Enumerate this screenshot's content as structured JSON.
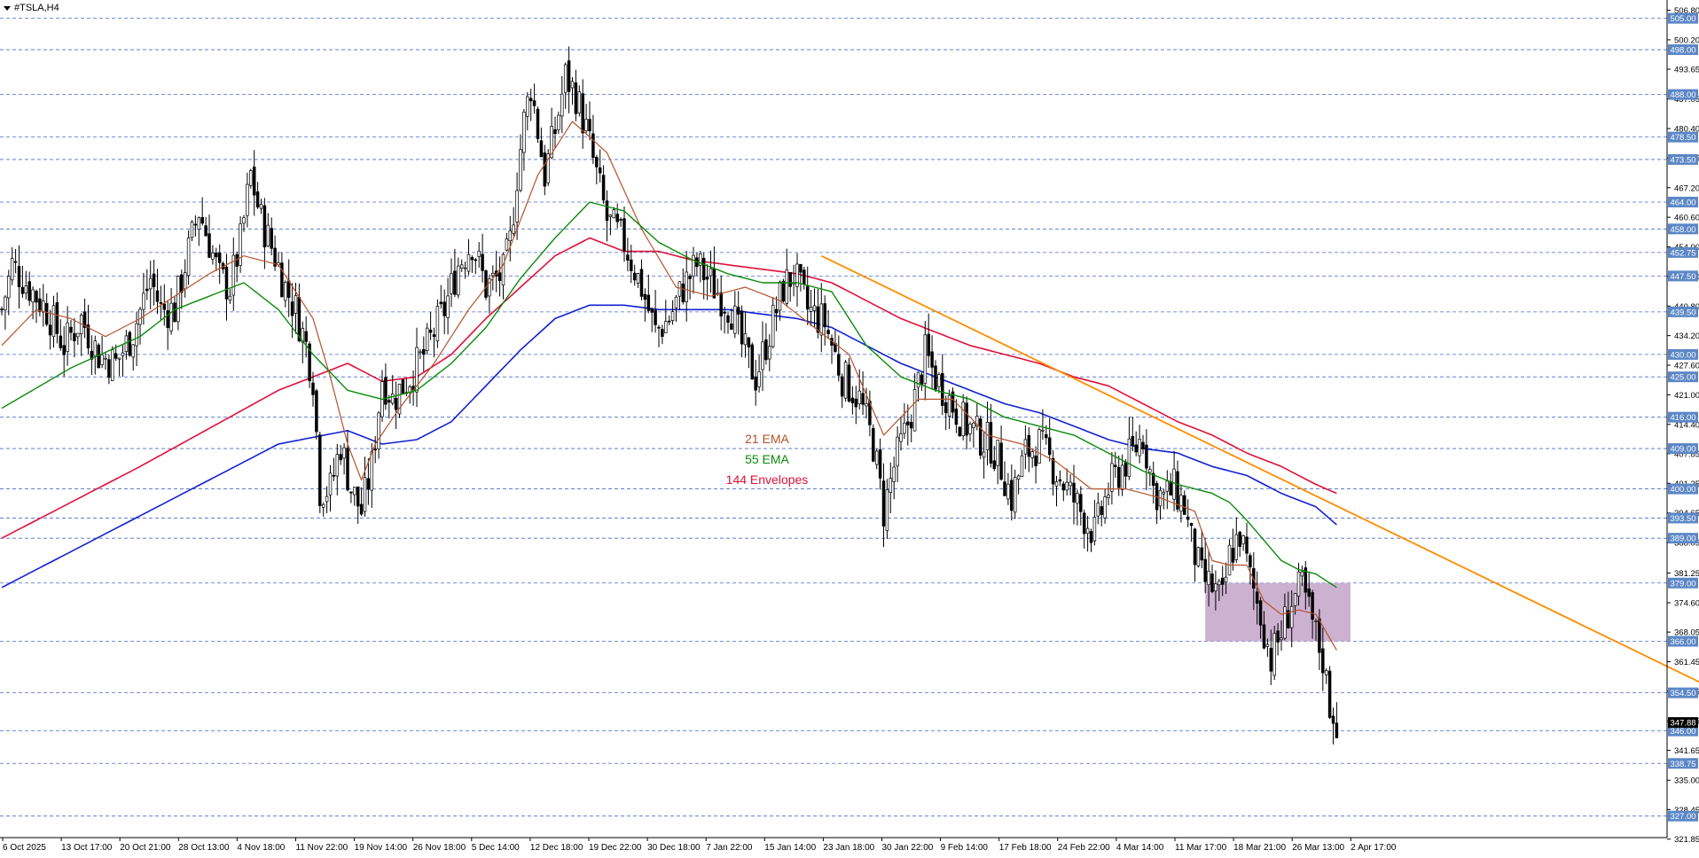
{
  "window": {
    "symbol_title": "#TSLA,H4"
  },
  "colors": {
    "background": "#ffffff",
    "grid": "#9aa8c8",
    "level_line": "#4a6bcc",
    "level_label_bg": "#5b87c6",
    "candle": "#000000",
    "ema21": "#b5532a",
    "ema55": "#0a8a0a",
    "envelope_upper": "#e0103a",
    "envelope_lower": "#1020d0",
    "trendline": "#ff8c00",
    "zone_fill": "#c7a8cc"
  },
  "legend": {
    "ema21": {
      "label": "21 EMA",
      "color": "#b5532a"
    },
    "ema55": {
      "label": "55 EMA",
      "color": "#0a8a0a"
    },
    "envelopes": {
      "label": "144 Envelopes",
      "color": "#e0103a"
    }
  },
  "chart_data": {
    "type": "candlestick",
    "title": "#TSLA,H4",
    "ylim": [
      321.6,
      507.7
    ],
    "price_axis_ticks": [
      "506.80",
      "500.20",
      "493.65",
      "487.05",
      "480.40",
      "473.85",
      "467.20",
      "460.60",
      "454.00",
      "447.40",
      "440.80",
      "434.20",
      "427.60",
      "421.00",
      "414.40",
      "407.85",
      "401.25",
      "394.65",
      "388.05",
      "381.25",
      "374.60",
      "368.05",
      "361.45",
      "354.85",
      "348.25",
      "341.65",
      "335.00",
      "328.45",
      "321.85"
    ],
    "horizontal_levels": [
      "505.00",
      "498.00",
      "488.00",
      "478.50",
      "473.50",
      "464.00",
      "458.00",
      "452.75",
      "447.50",
      "439.50",
      "430.00",
      "425.00",
      "416.00",
      "409.00",
      "400.00",
      "393.50",
      "389.00",
      "379.00",
      "366.00",
      "354.50",
      "346.00",
      "338.75",
      "327.00"
    ],
    "current_price": "347.88",
    "time_axis_labels": [
      "6 Oct 2025",
      "13 Oct 17:00",
      "20 Oct 21:00",
      "28 Oct 13:00",
      "4 Nov 18:00",
      "11 Nov 22:00",
      "19 Nov 14:00",
      "26 Nov 18:00",
      "5 Dec 14:00",
      "12 Dec 18:00",
      "19 Dec 22:00",
      "30 Dec 18:00",
      "7 Jan 22:00",
      "15 Jan 14:00",
      "23 Jan 18:00",
      "30 Jan 22:00",
      "9 Feb 14:00",
      "17 Feb 18:00",
      "24 Feb 22:00",
      "4 Mar 14:00",
      "11 Mar 17:00",
      "18 Mar 21:00",
      "26 Mar 13:00",
      "2 Apr 17:00"
    ],
    "price_path": [
      [
        0,
        440
      ],
      [
        3,
        450
      ],
      [
        8,
        445
      ],
      [
        13,
        440
      ],
      [
        18,
        432
      ],
      [
        23,
        438
      ],
      [
        28,
        430
      ],
      [
        33,
        428
      ],
      [
        38,
        435
      ],
      [
        43,
        447
      ],
      [
        46,
        440
      ],
      [
        50,
        440
      ],
      [
        53,
        450
      ],
      [
        57,
        462
      ],
      [
        60,
        455
      ],
      [
        63,
        447
      ],
      [
        66,
        445
      ],
      [
        69,
        455
      ],
      [
        72,
        470
      ],
      [
        75,
        460
      ],
      [
        79,
        452
      ],
      [
        82,
        445
      ],
      [
        85,
        440
      ],
      [
        88,
        432
      ],
      [
        90,
        425
      ],
      [
        92,
        400
      ],
      [
        95,
        400
      ],
      [
        98,
        410
      ],
      [
        101,
        400
      ],
      [
        104,
        395
      ],
      [
        107,
        405
      ],
      [
        110,
        425
      ],
      [
        113,
        420
      ],
      [
        118,
        425
      ],
      [
        122,
        430
      ],
      [
        128,
        440
      ],
      [
        132,
        450
      ],
      [
        136,
        455
      ],
      [
        140,
        445
      ],
      [
        145,
        448
      ],
      [
        147,
        455
      ],
      [
        149,
        470
      ],
      [
        151,
        482
      ],
      [
        153,
        490
      ],
      [
        155,
        480
      ],
      [
        157,
        470
      ],
      [
        160,
        480
      ],
      [
        163,
        492
      ],
      [
        166,
        488
      ],
      [
        169,
        480
      ],
      [
        172,
        470
      ],
      [
        175,
        460
      ],
      [
        180,
        455
      ],
      [
        185,
        445
      ],
      [
        189,
        435
      ],
      [
        193,
        438
      ],
      [
        197,
        445
      ],
      [
        201,
        450
      ],
      [
        206,
        445
      ],
      [
        211,
        440
      ],
      [
        214,
        432
      ],
      [
        218,
        425
      ],
      [
        222,
        435
      ],
      [
        226,
        445
      ],
      [
        229,
        448
      ],
      [
        233,
        440
      ],
      [
        238,
        437
      ],
      [
        243,
        425
      ],
      [
        248,
        420
      ],
      [
        252,
        410
      ],
      [
        255,
        395
      ],
      [
        258,
        405
      ],
      [
        261,
        412
      ],
      [
        264,
        420
      ],
      [
        267,
        430
      ],
      [
        270,
        425
      ],
      [
        274,
        420
      ],
      [
        278,
        415
      ],
      [
        282,
        412
      ],
      [
        286,
        410
      ],
      [
        289,
        405
      ],
      [
        292,
        398
      ],
      [
        296,
        408
      ],
      [
        300,
        410
      ],
      [
        304,
        405
      ],
      [
        308,
        400
      ],
      [
        312,
        395
      ],
      [
        316,
        390
      ],
      [
        320,
        400
      ],
      [
        324,
        405
      ],
      [
        327,
        408
      ],
      [
        330,
        412
      ],
      [
        333,
        400
      ],
      [
        336,
        398
      ],
      [
        339,
        400
      ],
      [
        342,
        396
      ],
      [
        344,
        388
      ],
      [
        347,
        380
      ],
      [
        350,
        378
      ],
      [
        353,
        375
      ],
      [
        355,
        385
      ],
      [
        358,
        390
      ],
      [
        361,
        380
      ],
      [
        364,
        372
      ],
      [
        367,
        362
      ],
      [
        370,
        368
      ],
      [
        373,
        375
      ],
      [
        376,
        378
      ],
      [
        379,
        370
      ],
      [
        382,
        362
      ],
      [
        384,
        352
      ],
      [
        386,
        348
      ]
    ],
    "pink_zone": {
      "from_index": 348,
      "to_index": 390,
      "price_top": 379.0,
      "price_bottom": 366.0
    },
    "trendline": {
      "from": {
        "index": 237,
        "price": 452.0
      },
      "to": {
        "index": 496,
        "price": 355.0
      }
    },
    "lines": [
      {
        "name": "21 EMA",
        "anchors": [
          [
            0,
            432
          ],
          [
            10,
            440
          ],
          [
            20,
            438
          ],
          [
            30,
            434
          ],
          [
            40,
            438
          ],
          [
            50,
            443
          ],
          [
            60,
            448
          ],
          [
            70,
            452
          ],
          [
            80,
            450
          ],
          [
            90,
            438
          ],
          [
            95,
            425
          ],
          [
            100,
            410
          ],
          [
            104,
            402
          ],
          [
            108,
            410
          ],
          [
            115,
            418
          ],
          [
            125,
            428
          ],
          [
            135,
            440
          ],
          [
            145,
            450
          ],
          [
            155,
            470
          ],
          [
            165,
            482
          ],
          [
            175,
            475
          ],
          [
            185,
            458
          ],
          [
            195,
            445
          ],
          [
            205,
            443
          ],
          [
            215,
            445
          ],
          [
            225,
            442
          ],
          [
            235,
            436
          ],
          [
            245,
            430
          ],
          [
            255,
            412
          ],
          [
            265,
            420
          ],
          [
            275,
            420
          ],
          [
            285,
            412
          ],
          [
            295,
            410
          ],
          [
            305,
            406
          ],
          [
            315,
            400
          ],
          [
            325,
            400
          ],
          [
            335,
            398
          ],
          [
            345,
            395
          ],
          [
            350,
            384
          ],
          [
            355,
            383
          ],
          [
            360,
            383
          ],
          [
            365,
            375
          ],
          [
            370,
            372
          ],
          [
            375,
            373
          ],
          [
            380,
            372
          ],
          [
            386,
            364
          ]
        ]
      },
      {
        "name": "55 EMA",
        "anchors": [
          [
            0,
            418
          ],
          [
            20,
            427
          ],
          [
            40,
            434
          ],
          [
            50,
            440
          ],
          [
            60,
            443
          ],
          [
            70,
            446
          ],
          [
            80,
            440
          ],
          [
            90,
            430
          ],
          [
            100,
            422
          ],
          [
            110,
            420
          ],
          [
            120,
            422
          ],
          [
            130,
            428
          ],
          [
            140,
            436
          ],
          [
            150,
            447
          ],
          [
            160,
            456
          ],
          [
            170,
            464
          ],
          [
            180,
            462
          ],
          [
            190,
            455
          ],
          [
            200,
            451
          ],
          [
            210,
            448
          ],
          [
            220,
            446
          ],
          [
            230,
            446
          ],
          [
            240,
            444
          ],
          [
            250,
            432
          ],
          [
            260,
            425
          ],
          [
            270,
            422
          ],
          [
            280,
            420
          ],
          [
            290,
            416
          ],
          [
            300,
            414
          ],
          [
            310,
            412
          ],
          [
            320,
            408
          ],
          [
            330,
            404
          ],
          [
            340,
            401
          ],
          [
            350,
            399
          ],
          [
            355,
            397
          ],
          [
            360,
            393
          ],
          [
            370,
            384
          ],
          [
            375,
            382
          ],
          [
            380,
            381
          ],
          [
            386,
            378
          ]
        ]
      },
      {
        "name": "144 Envelopes upper",
        "anchors": [
          [
            0,
            389
          ],
          [
            40,
            405
          ],
          [
            80,
            422
          ],
          [
            100,
            428
          ],
          [
            110,
            424
          ],
          [
            120,
            425
          ],
          [
            130,
            430
          ],
          [
            140,
            438
          ],
          [
            150,
            445
          ],
          [
            160,
            452
          ],
          [
            170,
            456
          ],
          [
            180,
            453
          ],
          [
            190,
            453
          ],
          [
            200,
            451
          ],
          [
            210,
            450
          ],
          [
            220,
            449
          ],
          [
            230,
            448
          ],
          [
            240,
            446
          ],
          [
            250,
            442
          ],
          [
            260,
            438
          ],
          [
            270,
            435
          ],
          [
            280,
            432
          ],
          [
            290,
            430
          ],
          [
            300,
            428
          ],
          [
            310,
            425
          ],
          [
            320,
            423
          ],
          [
            330,
            419
          ],
          [
            340,
            415
          ],
          [
            350,
            412
          ],
          [
            360,
            408
          ],
          [
            370,
            405
          ],
          [
            380,
            401
          ],
          [
            386,
            399
          ]
        ]
      },
      {
        "name": "144 Envelopes lower",
        "anchors": [
          [
            0,
            378
          ],
          [
            40,
            394
          ],
          [
            80,
            410
          ],
          [
            100,
            413
          ],
          [
            110,
            410
          ],
          [
            120,
            411
          ],
          [
            130,
            415
          ],
          [
            140,
            423
          ],
          [
            150,
            431
          ],
          [
            160,
            438
          ],
          [
            170,
            441
          ],
          [
            180,
            441
          ],
          [
            190,
            440
          ],
          [
            200,
            440
          ],
          [
            210,
            440
          ],
          [
            220,
            439
          ],
          [
            230,
            438
          ],
          [
            240,
            436
          ],
          [
            250,
            432
          ],
          [
            260,
            428
          ],
          [
            270,
            425
          ],
          [
            280,
            422
          ],
          [
            290,
            419
          ],
          [
            300,
            417
          ],
          [
            310,
            414
          ],
          [
            320,
            411
          ],
          [
            330,
            409
          ],
          [
            340,
            408
          ],
          [
            350,
            405
          ],
          [
            360,
            403
          ],
          [
            370,
            399
          ],
          [
            380,
            396
          ],
          [
            386,
            392
          ]
        ]
      }
    ]
  }
}
